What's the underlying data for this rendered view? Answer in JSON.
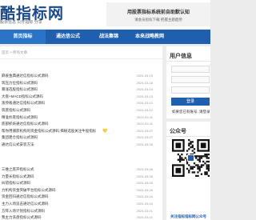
{
  "header": {
    "logo": "酷指标网",
    "slogan": "股票信息 公开指标 分享",
    "notice_title": "用股票指标系统前自助默认知",
    "notice_sub": "请会员指标下载 把握主题趋势"
  },
  "nav": {
    "items": [
      {
        "label": "首页指标",
        "active": true
      },
      {
        "label": "通达信公式",
        "active": false
      },
      {
        "label": "战法集锦",
        "active": false
      },
      {
        "label": "本来战略教网",
        "active": false
      }
    ]
  },
  "breadcrumb": "首页 > 所有文章",
  "list1": [
    {
      "title": "麻雀金典通达信指标公式源码",
      "date": "2024-03-19"
    },
    {
      "title": "筑压力位指标公式源码",
      "date": "2024-03-18"
    },
    {
      "title": "暴涨选股指标公式源码",
      "date": "2024-03-14"
    },
    {
      "title": "大盘+MACD指标公式源码",
      "date": "2024-03-13"
    },
    {
      "title": "涨停板通达信指标公式源码",
      "date": "2024-03-12"
    },
    {
      "title": "筑底指标公式源码",
      "date": "2024-03-12"
    },
    {
      "title": "精准抄底指标公式源码",
      "date": "2024-03-11"
    },
    {
      "title": "底部抓妖通达信指标公式源码",
      "date": "2024-03-11"
    },
    {
      "title": "帮你用捕获机构的资金指标公式源码,揭秘选股关注牛股指标",
      "date": "2024-03-07",
      "heart": "💛"
    },
    {
      "title": "集团建仓指标公式源码",
      "date": "2024-03-07"
    },
    {
      "title": "通达信公式安装方法",
      "date": "2024-03-06"
    }
  ],
  "list2": [
    {
      "title": "三维之底开指标公式",
      "date": "2024-03-06"
    },
    {
      "title": "力量长指标公式源码",
      "date": "2024-03-06"
    },
    {
      "title": "纠错指标公式源码",
      "date": "2024-03-05"
    },
    {
      "title": "力机构资金突破平台指标公式源码",
      "date": "2024-03-05"
    },
    {
      "title": "资金回归通达信指标公式源码",
      "date": "2024-03-04"
    },
    {
      "title": "主力入场追击通达信公式源码",
      "date": "2024-03-04"
    },
    {
      "title": "方阵入场计划指标公式源码",
      "date": "2024-03-01"
    },
    {
      "title": "我主力洗盘指标公式源码",
      "date": "2024-03-01"
    }
  ],
  "sidebar": {
    "user_title": "用户信息",
    "login_label": "登录",
    "login_note": "如果您已有账号, 请登录",
    "wechat_title": "公众号",
    "wechat_caption": "关注指标指标网公众号"
  },
  "colors": {
    "brand": "#1f5fae",
    "nav_active": "#2b73c7",
    "page_bg": "#ececec"
  }
}
